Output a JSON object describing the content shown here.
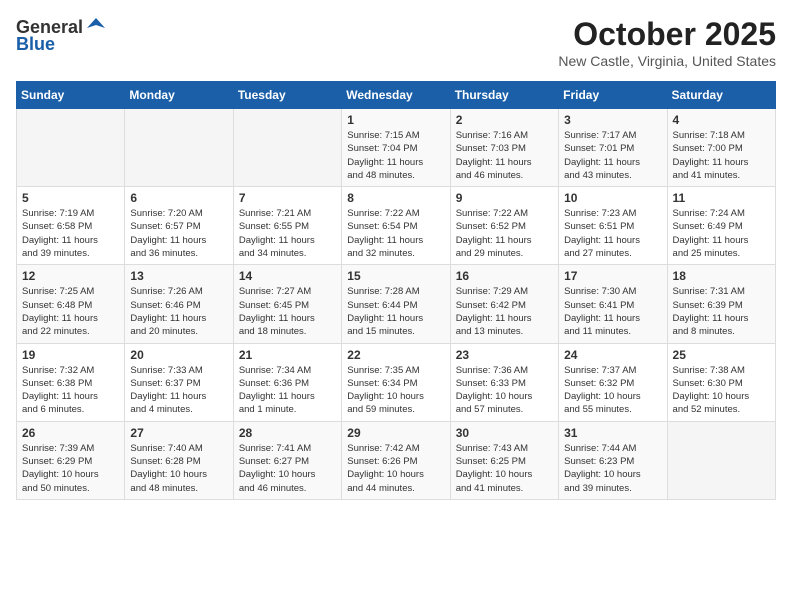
{
  "header": {
    "logo_line1": "General",
    "logo_line2": "Blue",
    "month_title": "October 2025",
    "location": "New Castle, Virginia, United States"
  },
  "weekdays": [
    "Sunday",
    "Monday",
    "Tuesday",
    "Wednesday",
    "Thursday",
    "Friday",
    "Saturday"
  ],
  "weeks": [
    [
      {
        "day": "",
        "info": ""
      },
      {
        "day": "",
        "info": ""
      },
      {
        "day": "",
        "info": ""
      },
      {
        "day": "1",
        "info": "Sunrise: 7:15 AM\nSunset: 7:04 PM\nDaylight: 11 hours\nand 48 minutes."
      },
      {
        "day": "2",
        "info": "Sunrise: 7:16 AM\nSunset: 7:03 PM\nDaylight: 11 hours\nand 46 minutes."
      },
      {
        "day": "3",
        "info": "Sunrise: 7:17 AM\nSunset: 7:01 PM\nDaylight: 11 hours\nand 43 minutes."
      },
      {
        "day": "4",
        "info": "Sunrise: 7:18 AM\nSunset: 7:00 PM\nDaylight: 11 hours\nand 41 minutes."
      }
    ],
    [
      {
        "day": "5",
        "info": "Sunrise: 7:19 AM\nSunset: 6:58 PM\nDaylight: 11 hours\nand 39 minutes."
      },
      {
        "day": "6",
        "info": "Sunrise: 7:20 AM\nSunset: 6:57 PM\nDaylight: 11 hours\nand 36 minutes."
      },
      {
        "day": "7",
        "info": "Sunrise: 7:21 AM\nSunset: 6:55 PM\nDaylight: 11 hours\nand 34 minutes."
      },
      {
        "day": "8",
        "info": "Sunrise: 7:22 AM\nSunset: 6:54 PM\nDaylight: 11 hours\nand 32 minutes."
      },
      {
        "day": "9",
        "info": "Sunrise: 7:22 AM\nSunset: 6:52 PM\nDaylight: 11 hours\nand 29 minutes."
      },
      {
        "day": "10",
        "info": "Sunrise: 7:23 AM\nSunset: 6:51 PM\nDaylight: 11 hours\nand 27 minutes."
      },
      {
        "day": "11",
        "info": "Sunrise: 7:24 AM\nSunset: 6:49 PM\nDaylight: 11 hours\nand 25 minutes."
      }
    ],
    [
      {
        "day": "12",
        "info": "Sunrise: 7:25 AM\nSunset: 6:48 PM\nDaylight: 11 hours\nand 22 minutes."
      },
      {
        "day": "13",
        "info": "Sunrise: 7:26 AM\nSunset: 6:46 PM\nDaylight: 11 hours\nand 20 minutes."
      },
      {
        "day": "14",
        "info": "Sunrise: 7:27 AM\nSunset: 6:45 PM\nDaylight: 11 hours\nand 18 minutes."
      },
      {
        "day": "15",
        "info": "Sunrise: 7:28 AM\nSunset: 6:44 PM\nDaylight: 11 hours\nand 15 minutes."
      },
      {
        "day": "16",
        "info": "Sunrise: 7:29 AM\nSunset: 6:42 PM\nDaylight: 11 hours\nand 13 minutes."
      },
      {
        "day": "17",
        "info": "Sunrise: 7:30 AM\nSunset: 6:41 PM\nDaylight: 11 hours\nand 11 minutes."
      },
      {
        "day": "18",
        "info": "Sunrise: 7:31 AM\nSunset: 6:39 PM\nDaylight: 11 hours\nand 8 minutes."
      }
    ],
    [
      {
        "day": "19",
        "info": "Sunrise: 7:32 AM\nSunset: 6:38 PM\nDaylight: 11 hours\nand 6 minutes."
      },
      {
        "day": "20",
        "info": "Sunrise: 7:33 AM\nSunset: 6:37 PM\nDaylight: 11 hours\nand 4 minutes."
      },
      {
        "day": "21",
        "info": "Sunrise: 7:34 AM\nSunset: 6:36 PM\nDaylight: 11 hours\nand 1 minute."
      },
      {
        "day": "22",
        "info": "Sunrise: 7:35 AM\nSunset: 6:34 PM\nDaylight: 10 hours\nand 59 minutes."
      },
      {
        "day": "23",
        "info": "Sunrise: 7:36 AM\nSunset: 6:33 PM\nDaylight: 10 hours\nand 57 minutes."
      },
      {
        "day": "24",
        "info": "Sunrise: 7:37 AM\nSunset: 6:32 PM\nDaylight: 10 hours\nand 55 minutes."
      },
      {
        "day": "25",
        "info": "Sunrise: 7:38 AM\nSunset: 6:30 PM\nDaylight: 10 hours\nand 52 minutes."
      }
    ],
    [
      {
        "day": "26",
        "info": "Sunrise: 7:39 AM\nSunset: 6:29 PM\nDaylight: 10 hours\nand 50 minutes."
      },
      {
        "day": "27",
        "info": "Sunrise: 7:40 AM\nSunset: 6:28 PM\nDaylight: 10 hours\nand 48 minutes."
      },
      {
        "day": "28",
        "info": "Sunrise: 7:41 AM\nSunset: 6:27 PM\nDaylight: 10 hours\nand 46 minutes."
      },
      {
        "day": "29",
        "info": "Sunrise: 7:42 AM\nSunset: 6:26 PM\nDaylight: 10 hours\nand 44 minutes."
      },
      {
        "day": "30",
        "info": "Sunrise: 7:43 AM\nSunset: 6:25 PM\nDaylight: 10 hours\nand 41 minutes."
      },
      {
        "day": "31",
        "info": "Sunrise: 7:44 AM\nSunset: 6:23 PM\nDaylight: 10 hours\nand 39 minutes."
      },
      {
        "day": "",
        "info": ""
      }
    ]
  ]
}
